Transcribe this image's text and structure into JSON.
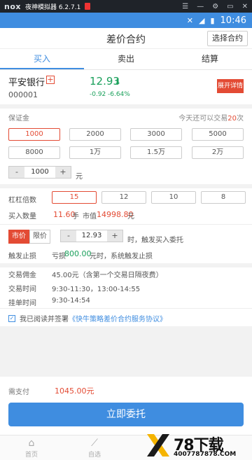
{
  "emulator": {
    "logo": "nox",
    "title": "夜神模拟器 6.2.7.1"
  },
  "status_bar": {
    "time": "10:46"
  },
  "header": {
    "title": "差价合约",
    "select_button": "选择合约"
  },
  "tabs": [
    {
      "label": "买入"
    },
    {
      "label": "卖出"
    },
    {
      "label": "结算"
    }
  ],
  "stock": {
    "name": "平安银行",
    "code": "000001",
    "price": "12.93",
    "change": "-0.92",
    "change_pct": "-6.64%",
    "detail_button": "展开详情"
  },
  "margin": {
    "label": "保证金",
    "hint_prefix": "今天还可以交易",
    "hint_count": "20",
    "hint_suffix": "次",
    "amounts": [
      "1000",
      "2000",
      "3000",
      "5000",
      "8000",
      "1万",
      "1.5万",
      "2万"
    ],
    "custom_value": "1000",
    "unit": "元"
  },
  "leverage": {
    "label": "杠杠倍数",
    "options": [
      "15",
      "12",
      "10",
      "8"
    ]
  },
  "quantity": {
    "label": "买入数量",
    "value": "11.60",
    "unit": "手",
    "mv_label": "市值",
    "mv_value": "14998.80",
    "mv_unit": "元"
  },
  "order": {
    "market": "市价",
    "limit": "限价",
    "price_value": "12.93",
    "trigger_text": "时，触发买入委托"
  },
  "stop_loss": {
    "label": "触发止损",
    "prefix": "亏损",
    "amount": "800.00",
    "suffix": "元时，系统触发止损"
  },
  "info": {
    "commission_label": "交易佣金",
    "commission_value": "45.00元（含第一个交易日隔夜费）",
    "time_label": "交易时间",
    "time_value": "9:30-11:30，13:00-14:55",
    "order_time_label": "挂单时间",
    "order_time_value": "9:30-14:54"
  },
  "agreement": {
    "text": "我已阅读并签署",
    "link": "《快牛策略差价合约服务协议》"
  },
  "payment": {
    "label": "需支付",
    "value": "1045.00元"
  },
  "submit_label": "立即委托",
  "nav": [
    {
      "label": "首页"
    },
    {
      "label": "自选"
    }
  ],
  "watermark": {
    "brand": "78下载",
    "site": "4007787878.COM"
  }
}
